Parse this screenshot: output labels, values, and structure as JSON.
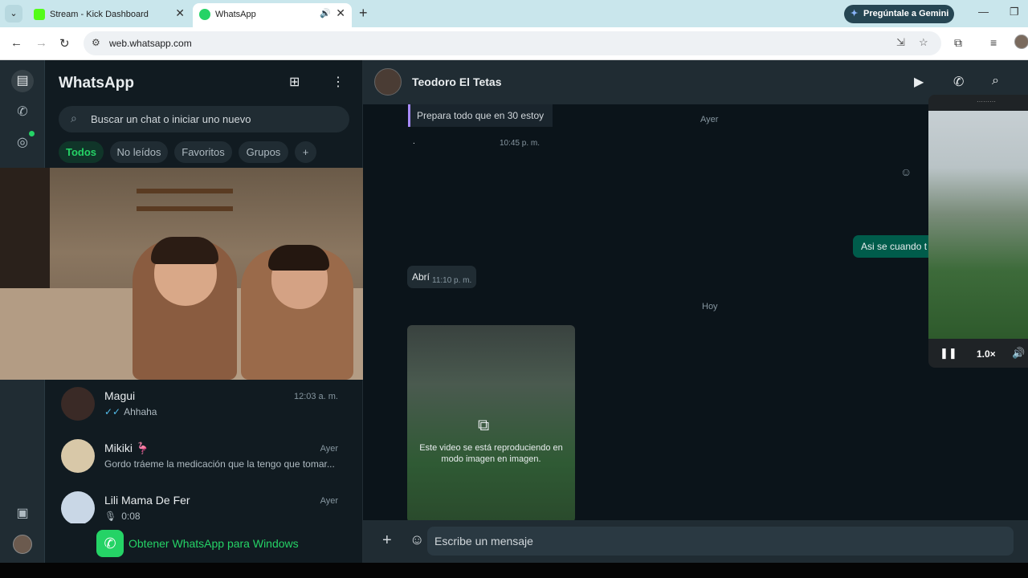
{
  "browser": {
    "tabs": [
      {
        "title": "Stream - Kick Dashboard",
        "favicon_color": "#53fc18",
        "close": "✕"
      },
      {
        "title": "WhatsApp",
        "favicon_color": "#25d366",
        "close": "✕",
        "audio": "🔊"
      }
    ],
    "new_tab": "+",
    "gemini_label": "Pregúntale a Gemini",
    "url": "web.whatsapp.com",
    "colors": {
      "tabstrip": "#c9e6ec",
      "gemini_bg": "#264653"
    }
  },
  "app": {
    "title": "WhatsApp",
    "search_placeholder": "Buscar un chat o iniciar uno nuevo",
    "filters": [
      "Todos",
      "No leídos",
      "Favoritos",
      "Grupos",
      "+"
    ],
    "chats": [
      {
        "name": "Magui",
        "time": "12:03 a. m.",
        "preview": "Ahhaha",
        "status": "read"
      },
      {
        "name": "Mikiki 🦩",
        "time": "Ayer",
        "preview": "Gordo tráeme la medicación que la tengo que tomar..."
      },
      {
        "name": "Lili Mama De Fer",
        "time": "Ayer",
        "preview": "0:08",
        "voice": true
      }
    ],
    "get_app": "Obtener WhatsApp para Windows",
    "accent": "#25d366"
  },
  "conversation": {
    "contact": "Teodoro El Tetas",
    "messages": {
      "quoted": "Prepara todo que en 30 estoy",
      "quoted_time": "10:45 p. m.",
      "dot": ".",
      "day_yesterday": "Ayer",
      "out_text": "Asi se cuando t",
      "in_text": "Abrí",
      "in_time": "11:10 p. m.",
      "day_today": "Hoy",
      "pip_notice": "Este video se está reproduciendo en modo imagen en imagen."
    },
    "composer_placeholder": "Escribe un mensaje"
  },
  "pip": {
    "speed": "1.0×"
  }
}
